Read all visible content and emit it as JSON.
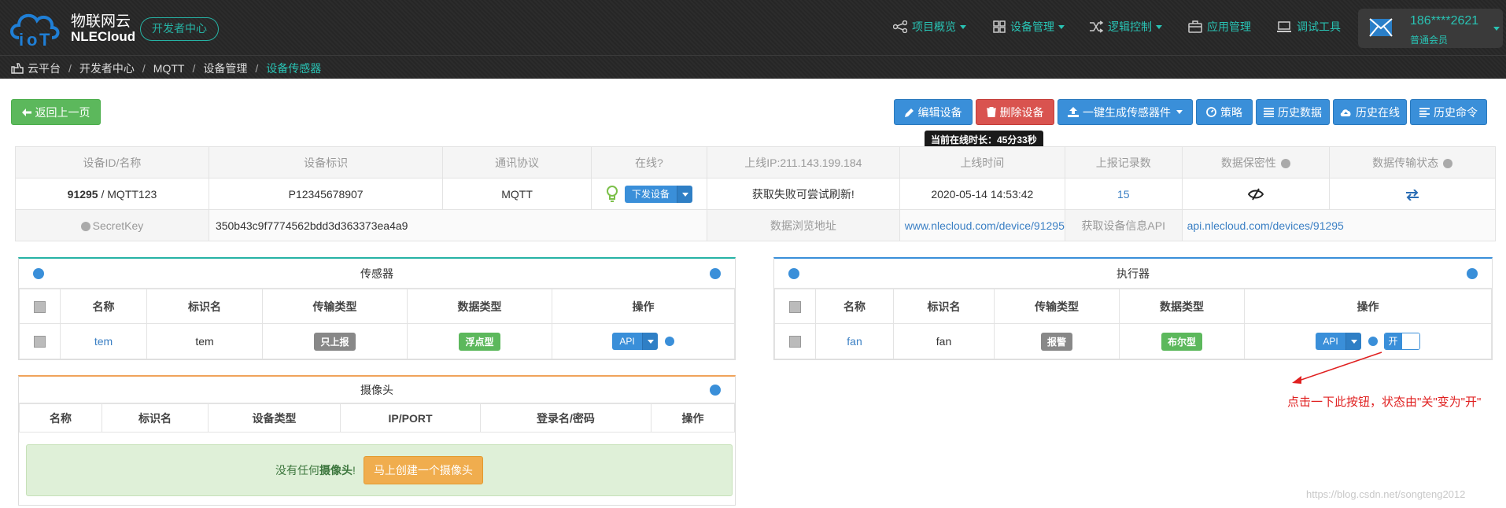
{
  "header": {
    "brand_cn": "物联网云",
    "brand_en": "NLECloud",
    "dev_center": "开发者中心",
    "nav": [
      {
        "label": "项目概览",
        "icon": "share-icon",
        "has_caret": true
      },
      {
        "label": "设备管理",
        "icon": "grid-icon",
        "has_caret": true
      },
      {
        "label": "逻辑控制",
        "icon": "shuffle-icon",
        "has_caret": true
      },
      {
        "label": "应用管理",
        "icon": "briefcase-icon",
        "has_caret": false
      },
      {
        "label": "调试工具",
        "icon": "laptop-icon",
        "has_caret": false
      }
    ],
    "user": {
      "name": "186****2621",
      "role": "普通会员",
      "icon": "mail-icon"
    }
  },
  "breadcrumb": [
    "云平台",
    "开发者中心",
    "MQTT",
    "设备管理",
    "设备传感器"
  ],
  "toolbar": {
    "back": "返回上一页",
    "edit": "编辑设备",
    "delete": "删除设备",
    "generate": "一键生成传感器件",
    "strategy": "策略",
    "history_data": "历史数据",
    "history_online": "历史在线",
    "history_cmd": "历史命令"
  },
  "tooltip": "当前在线时长：45分33秒",
  "device": {
    "headers": [
      "设备ID/名称",
      "设备标识",
      "通讯协议",
      "在线?",
      "上线IP:211.143.199.184",
      "上线时间",
      "上报记录数",
      "数据保密性",
      "数据传输状态"
    ],
    "id": "91295",
    "name": " / MQTT123",
    "tag": "P12345678907",
    "protocol": "MQTT",
    "send_label": "下发设备",
    "ip_status": "获取失败可尝试刷新!",
    "online_time": "2020-05-14 14:53:42",
    "report_count": "15",
    "secret_label": "SecretKey",
    "secret_value": "350b43c9f7774562bdd3d363373ea4a9",
    "browse_label": "数据浏览地址",
    "browse_url": "www.nlecloud.com/device/91295",
    "api_label": "获取设备信息API",
    "api_url": "api.nlecloud.com/devices/91295"
  },
  "sensors": {
    "title": "传感器",
    "columns": [
      "名称",
      "标识名",
      "传输类型",
      "数据类型",
      "操作"
    ],
    "row": {
      "name": "tem",
      "ident": "tem",
      "transfer": "只上报",
      "dtype": "浮点型",
      "op": "API"
    }
  },
  "actuators": {
    "title": "执行器",
    "columns": [
      "名称",
      "标识名",
      "传输类型",
      "数据类型",
      "操作"
    ],
    "row": {
      "name": "fan",
      "ident": "fan",
      "transfer": "报警",
      "dtype": "布尔型",
      "op": "API",
      "toggle": "开"
    }
  },
  "cameras": {
    "title": "摄像头",
    "columns": [
      "名称",
      "标识名",
      "设备类型",
      "IP/PORT",
      "登录名/密码",
      "操作"
    ],
    "empty_pre": "没有任何",
    "empty_bold": "摄像头",
    "empty_post": "!",
    "create": "马上创建一个摄像头"
  },
  "annotation": "点击一下此按钮，状态由\"关\"变为\"开\"",
  "watermark": "https://blog.csdn.net/songteng2012"
}
